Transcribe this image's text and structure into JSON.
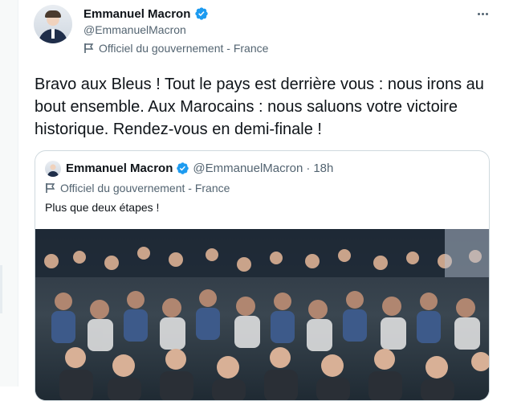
{
  "tweet": {
    "author": {
      "name": "Emmanuel Macron",
      "handle": "@EmmanuelMacron",
      "label": "Officiel du gouvernement - France"
    },
    "text": "Bravo aux Bleus ! Tout le pays est derrière vous : nous irons au bout ensemble. Aux Marocains : nous saluons votre victoire historique. Rendez-vous en demi-finale !"
  },
  "quoted": {
    "author": {
      "name": "Emmanuel Macron",
      "handle": "@EmmanuelMacron",
      "label": "Officiel du gouvernement - France"
    },
    "separator": "·",
    "time": "18h",
    "text": "Plus que deux étapes !"
  },
  "colors": {
    "verified": "#1d9bf0",
    "secondary_text": "#536471",
    "border": "#cfd9de"
  }
}
